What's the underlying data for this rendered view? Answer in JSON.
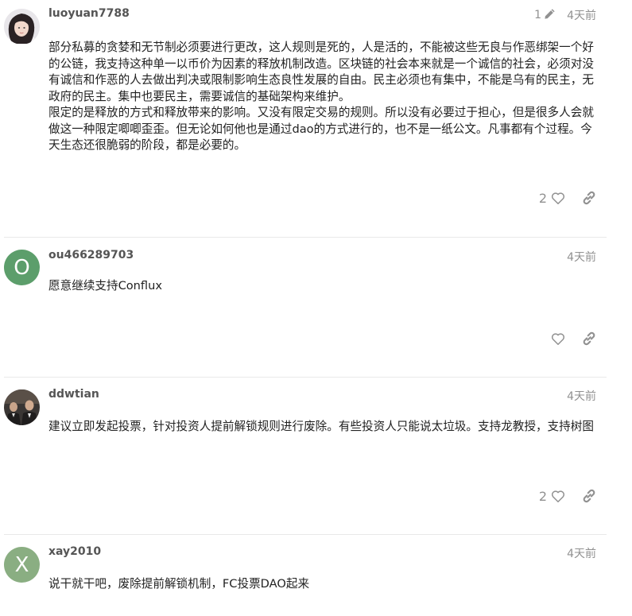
{
  "posts": [
    {
      "username": "luoyuan7788",
      "edit_count": "1",
      "time": "4天前",
      "paragraphs": [
        "部分私募的贪婪和无节制必须要进行更改，这人规则是死的，人是活的，不能被这些无良与作恶绑架一个好的公链，我支持这种单一以币价为因素的释放机制改造。区块链的社会本来就是一个诚信的社会，必须对没有诚信和作恶的人去做出判决或限制影响生态良性发展的自由。民主必须也有集中，不能是乌有的民主，无政府的民主。集中也要民主，需要诚信的基础架构来维护。",
        "限定的是释放的方式和释放带来的影响。又没有限定交易的规则。所以没有必要过于担心，但是很多人会就做这一种限定唧唧歪歪。但无论如何他也是通过dao的方式进行的，也不是一纸公文。凡事都有个过程。今天生态还很脆弱的阶段，都是必要的。"
      ],
      "like_count": "2"
    },
    {
      "username": "ou466289703",
      "avatar_letter": "O",
      "avatar_color": "#5c9e6b",
      "time": "4天前",
      "paragraphs": [
        "愿意继续支持Conflux"
      ],
      "like_count": ""
    },
    {
      "username": "ddwtian",
      "time": "4天前",
      "paragraphs": [
        "建议立即发起投票，针对投资人提前解锁规则进行废除。有些投资人只能说太垃圾。支持龙教授，支持树图"
      ],
      "like_count": "2"
    },
    {
      "username": "xay2010",
      "avatar_letter": "X",
      "avatar_color": "#8aae82",
      "time": "4天前",
      "paragraphs": [
        "说干就干吧，废除提前解锁机制，FC投票DAO起来"
      ]
    }
  ],
  "icons": {
    "edit": "pencil-icon",
    "like": "heart-icon",
    "share": "link-icon"
  }
}
